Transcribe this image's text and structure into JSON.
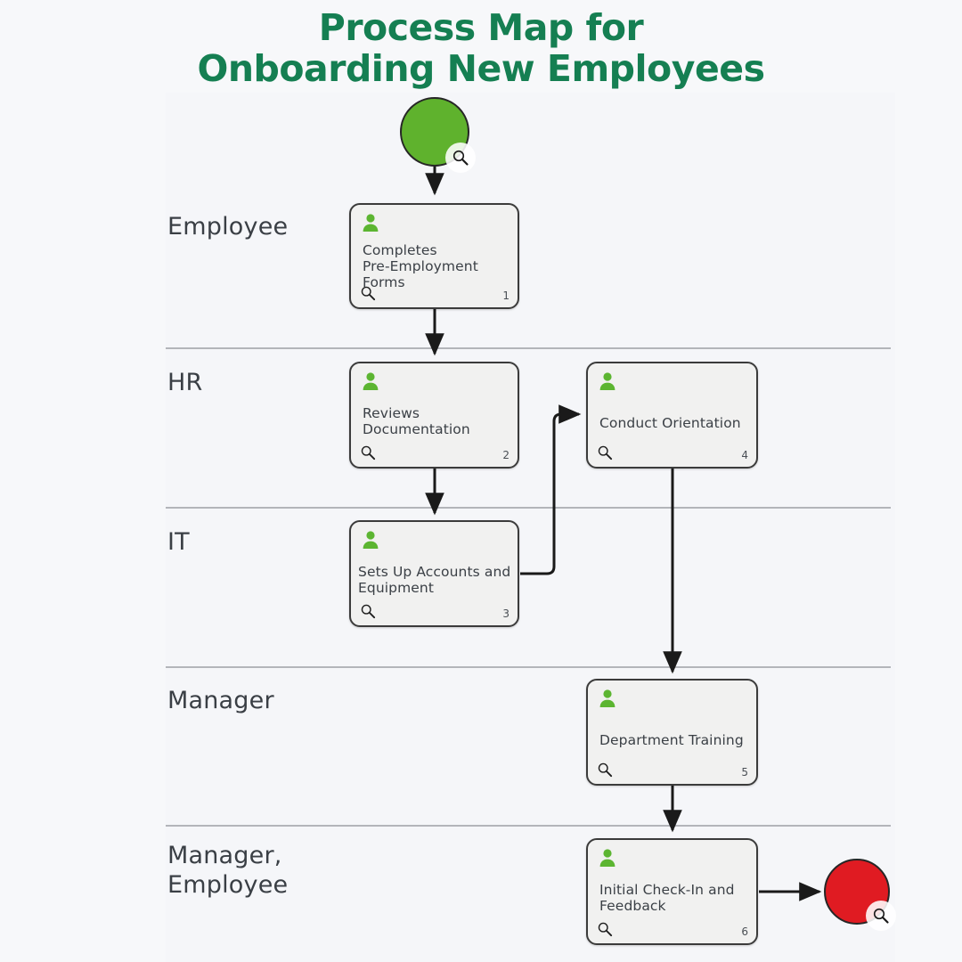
{
  "title": {
    "line1": "Process Map for",
    "line2": "Onboarding New Employees",
    "color": "#157f52"
  },
  "colors": {
    "background": "#f7f8fa",
    "panel": "#f5f6f9",
    "node_fill": "#f1f1f0",
    "node_border": "#3b3b3b",
    "person_icon": "#5cb531",
    "start_circle": "#5fb22d",
    "end_circle": "#e01b22",
    "lane_divider": "#b3b5ba",
    "text": "#3b4046",
    "lane_label": "#3a3f45"
  },
  "lanes": [
    {
      "id": "lane-employee",
      "label": "Employee"
    },
    {
      "id": "lane-hr",
      "label": "HR"
    },
    {
      "id": "lane-it",
      "label": "IT"
    },
    {
      "id": "lane-manager",
      "label": "Manager"
    },
    {
      "id": "lane-manager-employee",
      "label": "Manager,\nEmployee"
    }
  ],
  "terminators": [
    {
      "id": "start",
      "kind": "start-event",
      "shape": "circle",
      "color": "#5fb22d",
      "badge": "magnifier-icon"
    },
    {
      "id": "end",
      "kind": "end-event",
      "shape": "circle",
      "color": "#e01b22",
      "badge": "magnifier-icon"
    }
  ],
  "nodes": [
    {
      "id": "node-1",
      "number": "1",
      "label": "Completes\nPre-Employment\nForms",
      "lane": "Employee",
      "icon": "person-icon",
      "footer_icon": "magnifier-icon"
    },
    {
      "id": "node-2",
      "number": "2",
      "label": "Reviews\nDocumentation",
      "lane": "HR",
      "icon": "person-icon",
      "footer_icon": "magnifier-icon"
    },
    {
      "id": "node-3",
      "number": "3",
      "label": "Sets Up Accounts and\nEquipment",
      "lane": "IT",
      "icon": "person-icon",
      "footer_icon": "magnifier-icon"
    },
    {
      "id": "node-4",
      "number": "4",
      "label": "Conduct Orientation",
      "lane": "HR",
      "icon": "person-icon",
      "footer_icon": "magnifier-icon"
    },
    {
      "id": "node-5",
      "number": "5",
      "label": "Department Training",
      "lane": "Manager",
      "icon": "person-icon",
      "footer_icon": "magnifier-icon"
    },
    {
      "id": "node-6",
      "number": "6",
      "label": "Initial Check-In and\nFeedback",
      "lane": "Manager, Employee",
      "icon": "person-icon",
      "footer_icon": "magnifier-icon"
    }
  ],
  "connections": [
    {
      "from": "start",
      "to": "node-1",
      "style": "straight-down"
    },
    {
      "from": "node-1",
      "to": "node-2",
      "style": "straight-down"
    },
    {
      "from": "node-2",
      "to": "node-3",
      "style": "straight-down"
    },
    {
      "from": "node-3",
      "to": "node-4",
      "style": "elbow-right-up"
    },
    {
      "from": "node-4",
      "to": "node-5",
      "style": "straight-down"
    },
    {
      "from": "node-5",
      "to": "node-6",
      "style": "straight-down"
    },
    {
      "from": "node-6",
      "to": "end",
      "style": "straight-right"
    }
  ]
}
